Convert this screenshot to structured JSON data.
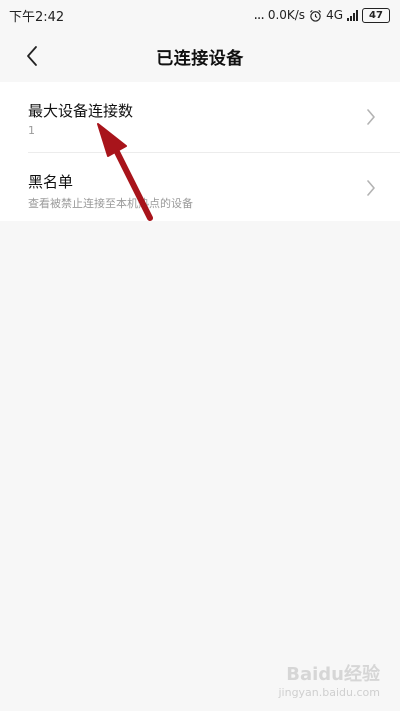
{
  "status_bar": {
    "time": "下午2:42",
    "dots": "...",
    "speed": "0.0K/s",
    "alarm_icon": "alarm-icon",
    "network": "4G",
    "battery": "47"
  },
  "header": {
    "title": "已连接设备",
    "back_icon": "chevron-left-icon"
  },
  "settings": [
    {
      "title": "最大设备连接数",
      "subtitle": "1"
    },
    {
      "title": "黑名单",
      "subtitle": "查看被禁止连接至本机热点的设备"
    }
  ],
  "watermark": {
    "brand": "Baidu经验",
    "url": "jingyan.baidu.com"
  },
  "colors": {
    "background": "#f7f7f7",
    "list_bg": "#ffffff",
    "annotation_arrow": "#a8141b"
  }
}
